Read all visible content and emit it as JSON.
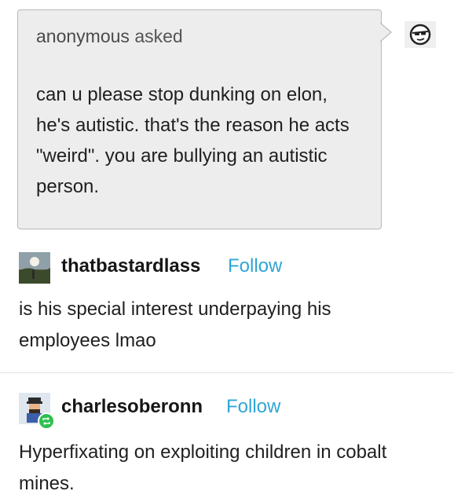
{
  "ask": {
    "asker": "anonymous",
    "verb": "asked",
    "body": "can u please stop dunking on elon, he's autistic. that's the reason he acts \"weird\". you are bullying an autistic person."
  },
  "posts": [
    {
      "username": "thatbastardlass",
      "follow_label": "Follow",
      "text": "is his special interest underpaying his employees lmao",
      "avatar_icon": "landscape-photo-avatar"
    },
    {
      "username": "charlesoberonn",
      "follow_label": "Follow",
      "text": "Hyperfixating on exploiting children in cobalt mines.",
      "avatar_icon": "cartoon-character-avatar",
      "badge_icon": "reblog-icon"
    }
  ],
  "answerer": {
    "avatar_icon": "sunglasses-face-icon"
  },
  "colors": {
    "follow": "#2fa5d6",
    "ask_bg": "#ededed",
    "reblog_badge": "#2fbf4f"
  }
}
